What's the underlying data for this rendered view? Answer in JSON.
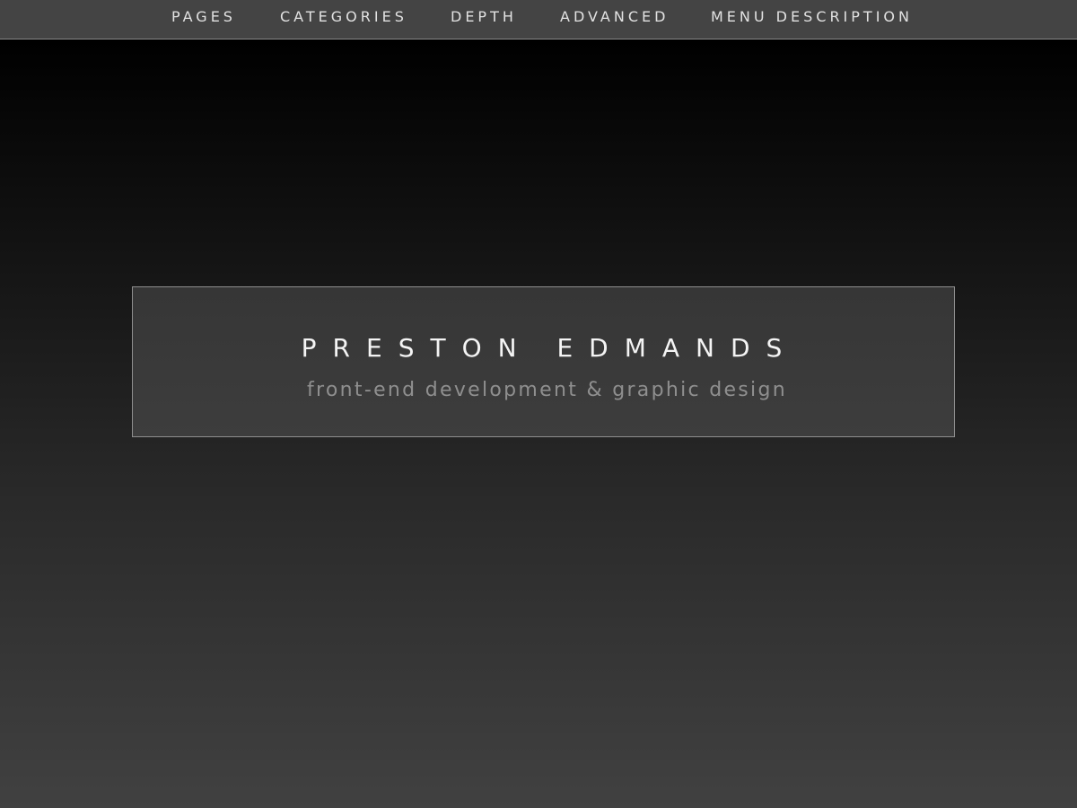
{
  "nav": {
    "items": [
      {
        "label": "PAGES"
      },
      {
        "label": "CATEGORIES"
      },
      {
        "label": "DEPTH"
      },
      {
        "label": "ADVANCED"
      },
      {
        "label": "MENU DESCRIPTION"
      }
    ]
  },
  "hero": {
    "title": "PRESTON EDMANDS",
    "subtitle": "front-end development & graphic design"
  },
  "colors": {
    "nav_background": "#444444",
    "page_gradient_top": "#000000",
    "page_gradient_bottom": "#414141",
    "hero_border": "#8e8e8e",
    "subtitle_text": "#8f8f8f"
  }
}
